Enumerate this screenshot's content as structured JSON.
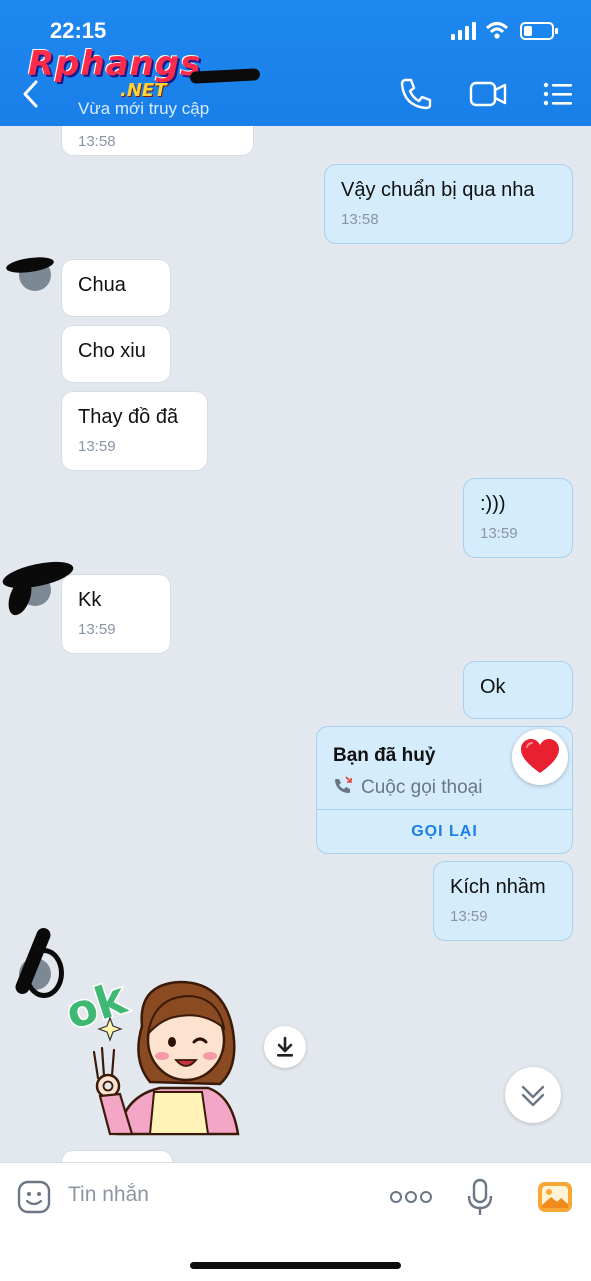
{
  "status_bar": {
    "time": "22:15"
  },
  "header": {
    "watermark_main": "Rphangs",
    "watermark_sub": ".NET",
    "subtitle": "Vừa mới truy cập",
    "icons": [
      "back-chevron",
      "phone",
      "video-camera",
      "menu-list"
    ]
  },
  "messages": [
    {
      "side": "in",
      "text": "",
      "time": "13:58"
    },
    {
      "side": "out",
      "text": "Vậy chuẩn bị qua nha",
      "time": "13:58"
    },
    {
      "side": "in",
      "text": "Chua",
      "time": ""
    },
    {
      "side": "in",
      "text": "Cho xiu",
      "time": ""
    },
    {
      "side": "in",
      "text": "Thay đồ đã",
      "time": "13:59"
    },
    {
      "side": "out",
      "text": ":)))",
      "time": "13:59"
    },
    {
      "side": "in",
      "text": "Kk",
      "time": "13:59"
    },
    {
      "side": "out",
      "text": "Ok",
      "time": ""
    },
    {
      "side": "out",
      "text": "Kích nhầm",
      "time": "13:59"
    }
  ],
  "call_card": {
    "title": "Bạn đã huỷ",
    "subtitle": "Cuộc gọi thoại",
    "action": "GỌI LẠI",
    "reaction": "heart"
  },
  "sticker": {
    "label": "ok"
  },
  "composer": {
    "placeholder": "Tin nhắn"
  },
  "colors": {
    "header": "#1a7fe8",
    "outgoing_bubble": "#d5ecfc",
    "incoming_bubble": "#ffffff",
    "chat_background": "#e3e8ef",
    "accent": "#1a7fe8"
  }
}
